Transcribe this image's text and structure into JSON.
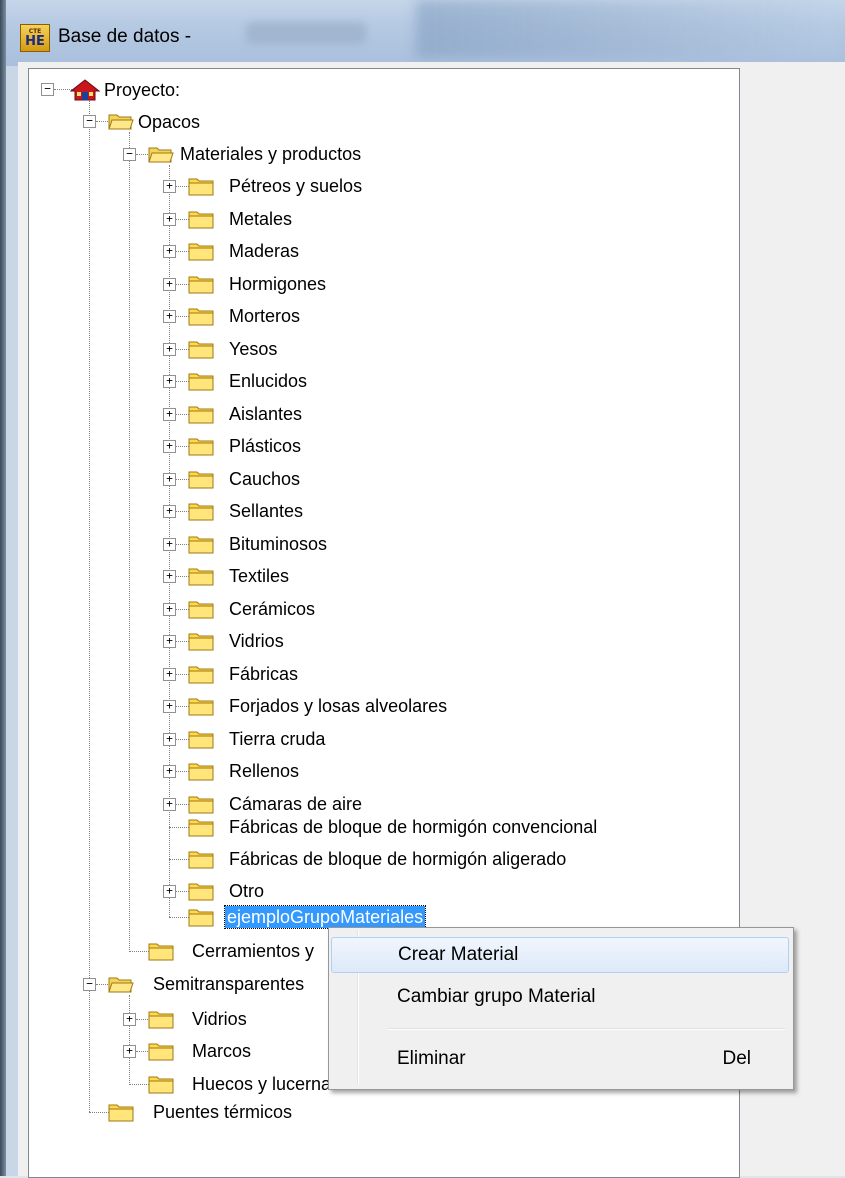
{
  "window": {
    "title": "Base de datos -",
    "icon_top": "CTE",
    "icon_bottom": "HE"
  },
  "colors": {
    "selection": "#3399ff",
    "folder": "#ffd94a",
    "house_roof": "#c8161d"
  },
  "tree": {
    "root": "Proyecto:",
    "opacos": "Opacos",
    "materiales": "Materiales y productos",
    "material_groups": [
      "Pétreos y suelos",
      "Metales",
      "Maderas",
      "Hormigones",
      "Morteros",
      "Yesos",
      "Enlucidos",
      "Aislantes",
      "Plásticos",
      "Cauchos",
      "Sellantes",
      "Bituminosos",
      "Textiles",
      "Cerámicos",
      "Vidrios",
      "Fábricas",
      "Forjados y losas alveolares",
      "Tierra cruda",
      "Rellenos",
      "Cámaras de aire"
    ],
    "fab_conv": "Fábricas de bloque de hormigón convencional",
    "fab_alig": "Fábricas de bloque de hormigón aligerado",
    "otro": "Otro",
    "selected": "ejemploGrupoMateriales",
    "cerramientos": "Cerramientos y",
    "semitransparentes": "Semitransparentes",
    "vidrios": "Vidrios",
    "marcos": "Marcos",
    "huecos": "Huecos y lucernarios",
    "puentes": "Puentes térmicos"
  },
  "context_menu": {
    "crear": "Crear Material",
    "cambiar": "Cambiar grupo Material",
    "eliminar": "Eliminar",
    "eliminar_shortcut": "Del"
  }
}
